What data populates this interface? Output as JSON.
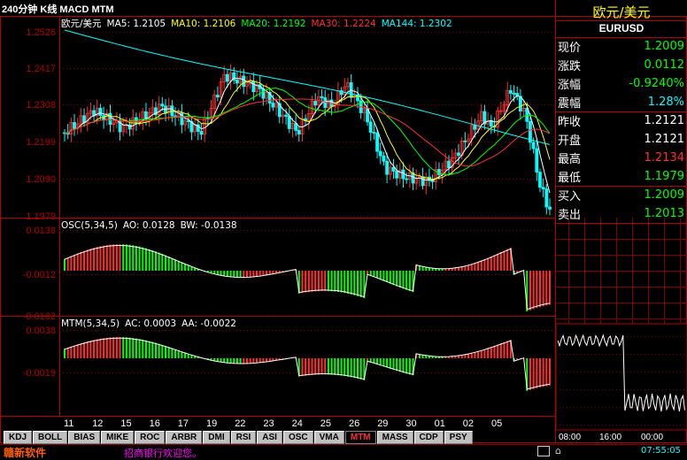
{
  "title": "240分钟 K线 MACD MTM",
  "instrument": {
    "name": "欧元/美元",
    "code": "EURUSD"
  },
  "quote": [
    {
      "label": "现价",
      "value": "1.2009",
      "color": "#00ff00"
    },
    {
      "label": "涨跌",
      "value": "0.0112",
      "color": "#00ff00"
    },
    {
      "label": "涨幅",
      "value": "-0.9240%",
      "color": "#00ff00"
    },
    {
      "label": "震幅",
      "value": "1.28%",
      "color": "#00ffff"
    },
    {
      "label": "昨收",
      "value": "1.2121",
      "color": "#ffffff"
    },
    {
      "label": "开盘",
      "value": "1.2121",
      "color": "#ffffff"
    },
    {
      "label": "最高",
      "value": "1.2134",
      "color": "#ff3030"
    },
    {
      "label": "最低",
      "value": "1.1979",
      "color": "#00ff00"
    },
    {
      "label": "买入",
      "value": "1.2009",
      "color": "#00ff00"
    },
    {
      "label": "卖出",
      "value": "1.2013",
      "color": "#00ff00"
    }
  ],
  "main_panel": {
    "legend": [
      {
        "text": "欧元/美元",
        "color": "#ffffff"
      },
      {
        "text": "MA5: 1.2105",
        "color": "#ffffff"
      },
      {
        "text": "MA10: 1.2106",
        "color": "#ffff00"
      },
      {
        "text": "MA20: 1.2192",
        "color": "#00ff00"
      },
      {
        "text": "MA30: 1.2224",
        "color": "#ff3030"
      },
      {
        "text": "MA144: 1.2302",
        "color": "#00ffff"
      }
    ],
    "y_ticks": [
      "1.2526",
      "1.2417",
      "1.2308",
      "1.2199",
      "1.2090",
      "1.1979"
    ]
  },
  "osc_panel": {
    "legend": [
      {
        "text": "OSC(5,34,5)",
        "color": "#ffffff"
      },
      {
        "text": "AO: 0.0128",
        "color": "#ffffff"
      },
      {
        "text": "BW: -0.0138",
        "color": "#ffffff"
      }
    ],
    "y_ticks": [
      "0.0138",
      "-0.0012",
      "-0.0162"
    ]
  },
  "mtm_panel": {
    "legend": [
      {
        "text": "MTM(5,34,5)",
        "color": "#ffffff"
      },
      {
        "text": "AC: 0.0003",
        "color": "#ffffff"
      },
      {
        "text": "AA: -0.0022",
        "color": "#ffffff"
      }
    ],
    "y_ticks": [
      "0.0038",
      "-0.0019"
    ]
  },
  "x_labels": [
    "11",
    "12",
    "15",
    "16",
    "17",
    "19",
    "22",
    "23",
    "24",
    "25",
    "26",
    "29",
    "30",
    "01",
    "02",
    "05"
  ],
  "intraday_x_labels": [
    "08:00",
    "16:00",
    "00:00"
  ],
  "tabs": [
    {
      "label": "KDJ",
      "active": false
    },
    {
      "label": "BOLL",
      "active": false
    },
    {
      "label": "BIAS",
      "active": false
    },
    {
      "label": "MIKE",
      "active": false
    },
    {
      "label": "ROC",
      "active": false
    },
    {
      "label": "ARBR",
      "active": false
    },
    {
      "label": "DMI",
      "active": false
    },
    {
      "label": "RSI",
      "active": false
    },
    {
      "label": "ASI",
      "active": false
    },
    {
      "label": "OSC",
      "active": false
    },
    {
      "label": "VMA",
      "active": false
    },
    {
      "label": "MTM",
      "active": true
    },
    {
      "label": "MASS",
      "active": false
    },
    {
      "label": "CDP",
      "active": false
    },
    {
      "label": "PSY",
      "active": false
    }
  ],
  "status": {
    "brand": "赣新软件",
    "ticker": "招商银行欢迎您。",
    "time": "07:55:05"
  },
  "colors": {
    "up": "#ff3030",
    "down": "#00ffff",
    "border": "#b00000",
    "grid": "#800000"
  }
}
